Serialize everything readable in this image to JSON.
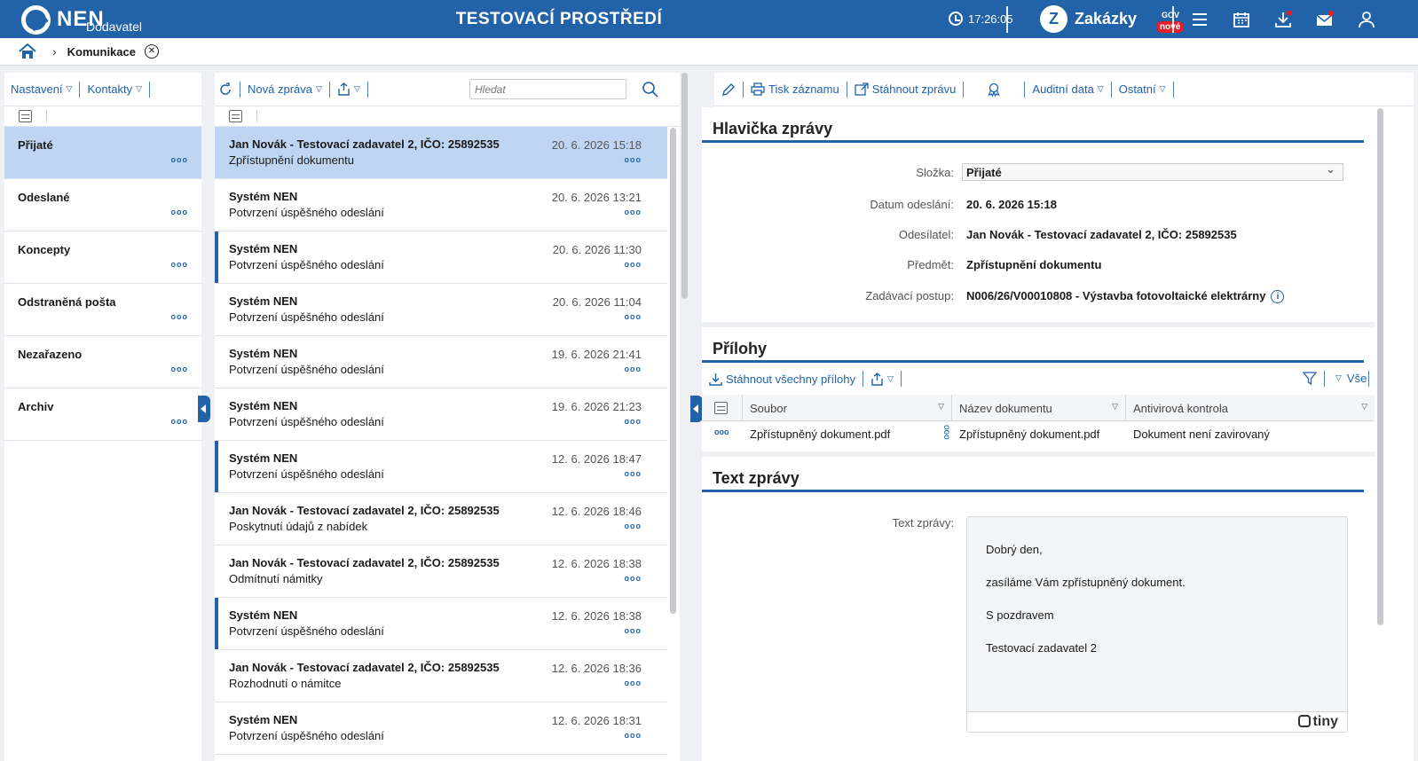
{
  "header": {
    "brand": "NEN",
    "brand_sub": "Dodavatel",
    "env_title": "TESTOVACÍ PROSTŘEDÍ",
    "clock": "17:26:05",
    "zakazky_title": "Zakázky",
    "zakazky_gov": "GOV",
    "zakazky_badge": "nové",
    "icons": [
      "menu-icon",
      "calendar-icon",
      "download-icon",
      "mail-icon",
      "user-icon"
    ],
    "accent_color": "#2162a8",
    "badge_color": "#e41e26"
  },
  "breadcrumb": {
    "current": "Komunikace"
  },
  "folders": {
    "toolbar": {
      "settings": "Nastavení",
      "contacts": "Kontakty"
    },
    "items": [
      {
        "label": "Přijaté",
        "active": true
      },
      {
        "label": "Odeslané"
      },
      {
        "label": "Koncepty"
      },
      {
        "label": "Odstraněná pošta"
      },
      {
        "label": "Nezařazeno"
      },
      {
        "label": "Archiv"
      }
    ]
  },
  "messages": {
    "toolbar": {
      "new_message": "Nová zpráva",
      "search_placeholder": "Hledat"
    },
    "items": [
      {
        "sender": "Jan Novák - Testovací zadavatel 2, IČO: 25892535",
        "subject": "Zpřístupnění dokumentu",
        "date": "20. 6. 2026 15:18",
        "active": true,
        "unread": false
      },
      {
        "sender": "Systém NEN",
        "subject": "Potvrzení úspěšného odeslání",
        "date": "20. 6. 2026 13:21",
        "unread": false
      },
      {
        "sender": "Systém NEN",
        "subject": "Potvrzení úspěšného odeslání",
        "date": "20. 6. 2026 11:30",
        "unread": true
      },
      {
        "sender": "Systém NEN",
        "subject": "Potvrzení úspěšného odeslání",
        "date": "20. 6. 2026 11:04",
        "unread": false
      },
      {
        "sender": "Systém NEN",
        "subject": "Potvrzení úspěšného odeslání",
        "date": "19. 6. 2026 21:41",
        "unread": false
      },
      {
        "sender": "Systém NEN",
        "subject": "Potvrzení úspěšného odeslání",
        "date": "19. 6. 2026 21:23",
        "unread": false
      },
      {
        "sender": "Systém NEN",
        "subject": "Potvrzení úspěšného odeslání",
        "date": "12. 6. 2026 18:47",
        "unread": true
      },
      {
        "sender": "Jan Novák - Testovací zadavatel 2, IČO: 25892535",
        "subject": "Poskytnutí údajů z nabídek",
        "date": "12. 6. 2026 18:46",
        "unread": false
      },
      {
        "sender": "Jan Novák - Testovací zadavatel 2, IČO: 25892535",
        "subject": "Odmítnutí námitky",
        "date": "12. 6. 2026 18:38",
        "unread": false
      },
      {
        "sender": "Systém NEN",
        "subject": "Potvrzení úspěšného odeslání",
        "date": "12. 6. 2026 18:38",
        "unread": true
      },
      {
        "sender": "Jan Novák - Testovací zadavatel 2, IČO: 25892535",
        "subject": "Rozhodnutí o námitce",
        "date": "12. 6. 2026 18:36",
        "unread": false
      },
      {
        "sender": "Systém NEN",
        "subject": "Potvrzení úspěšného odeslání",
        "date": "12. 6. 2026 18:31",
        "unread": false
      }
    ]
  },
  "detail": {
    "toolbar": {
      "print": "Tisk záznamu",
      "download": "Stáhnout zprávu",
      "audit": "Auditní data",
      "other": "Ostatní"
    },
    "header_section": {
      "title": "Hlavička zprávy",
      "folder_label": "Složka:",
      "folder_value": "Přijaté",
      "sent_label": "Datum odeslání:",
      "sent_value": "20. 6. 2026 15:18",
      "sender_label": "Odesílatel:",
      "sender_value": "Jan Novák - Testovací zadavatel 2, IČO: 25892535",
      "subject_label": "Předmět:",
      "subject_value": "Zpřístupnění dokumentu",
      "procedure_label": "Zadávací postup:",
      "procedure_value": "N006/26/V00010808 - Výstavba fotovoltaické elektrárny"
    },
    "attachments": {
      "title": "Přílohy",
      "download_all": "Stáhnout všechny přílohy",
      "filter_all": "Vše",
      "columns": [
        "Soubor",
        "Název dokumentu",
        "Antivirová kontrola"
      ],
      "rows": [
        {
          "file": "Zpřístupněný dokument.pdf",
          "name": "Zpřístupněný dokument.pdf",
          "av": "Dokument není zavirovaný"
        }
      ]
    },
    "text_section": {
      "title": "Text zprávy",
      "label": "Text zprávy:",
      "paragraphs": [
        "Dobrý den,",
        "zasíláme Vám zpřístupněný dokument.",
        "S pozdravem",
        "Testovací zadavatel 2"
      ],
      "editor_brand": "tiny"
    }
  }
}
